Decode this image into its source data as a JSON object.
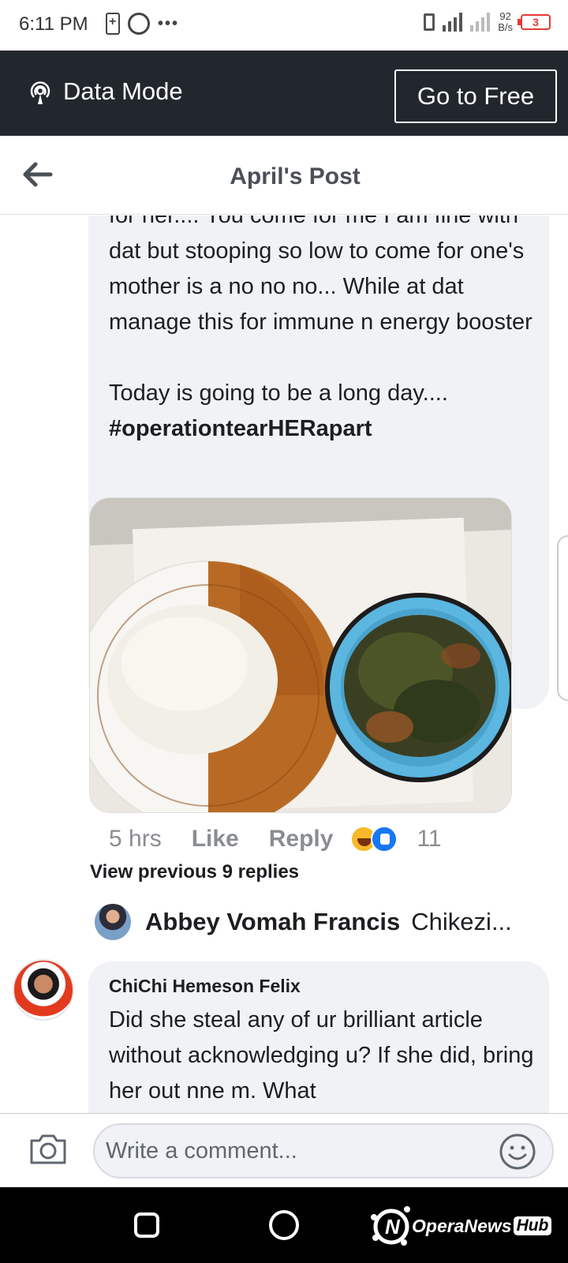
{
  "status_bar": {
    "time": "6:11 PM",
    "more_dots": "•••",
    "network_speed_value": "92",
    "network_speed_unit": "B/s",
    "battery_level": "3"
  },
  "data_bar": {
    "label": "Data Mode",
    "go_free_label": "Go to Free"
  },
  "header": {
    "title": "April's Post"
  },
  "post": {
    "body_text": "for her.... You come for me I am fine with dat but stooping so low to come for one's mother is a no no no... While at dat manage this for immune n energy booster\n\nToday is going to be a long day....",
    "hashtag": "#operationtearHERapart",
    "time": "5 hrs",
    "like_label": "Like",
    "reply_label": "Reply",
    "reaction_count": "11"
  },
  "replies": {
    "view_previous_label": "View previous 9 replies",
    "preview_name": "Abbey Vomah Francis",
    "preview_snippet": "Chikezi..."
  },
  "comment": {
    "author": "ChiChi Hemeson Felix",
    "text": "Did she steal any of ur brilliant article without acknowledging u? If she did, bring her out nne m. What"
  },
  "composer": {
    "placeholder": "Write a comment..."
  },
  "watermark": {
    "text": "OperaNews",
    "badge": "Hub"
  },
  "colors": {
    "data_bar_bg": "#22272e",
    "bubble_bg": "#f0f2f5",
    "meta_text": "#8a8d91",
    "like_blue": "#1877f2"
  }
}
